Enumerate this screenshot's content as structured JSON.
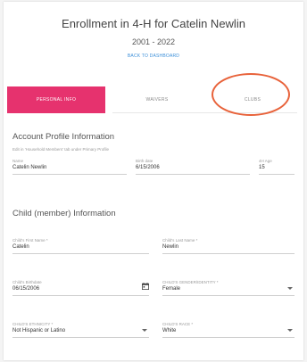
{
  "header": {
    "title": "Enrollment in 4-H for Catelin Newlin",
    "year": "2001 - 2022",
    "back_link": "BACK TO DASHBOARD"
  },
  "tabs": [
    {
      "label": "PERSONAL INFO",
      "active": true
    },
    {
      "label": "WAIVERS",
      "active": false
    },
    {
      "label": "CLUBS",
      "active": false
    }
  ],
  "account": {
    "heading": "Account Profile Information",
    "hint": "Edit in 'Household Members' tab under Primary Profile",
    "name_label": "Name",
    "name_value": "Catelin Newlin",
    "birthdate_label": "Birth date",
    "birthdate_value": "6/15/2006",
    "age_label": "4H Age",
    "age_value": "15"
  },
  "child": {
    "heading": "Child (member) Information",
    "first_name_label": "Child's First Name *",
    "first_name_value": "Catelin",
    "last_name_label": "Child's Last Name *",
    "last_name_value": "Newlin",
    "birthdate_label": "Child's Birthdate",
    "birthdate_value": "06/15/2006",
    "gender_label": "CHILD'S GENDER/IDENTITY *",
    "gender_value": "Female",
    "ethnicity_label": "CHILD'S ETHNICITY *",
    "ethnicity_value": "Not Hispanic or Latino",
    "race_label": "CHILD'S RACE *",
    "race_value": "White"
  },
  "colors": {
    "active_tab": "#e6326e",
    "annotation_circle": "#e8623a",
    "link": "#3b8fd9"
  },
  "icons": [
    "calendar-icon",
    "chevron-down-icon"
  ]
}
